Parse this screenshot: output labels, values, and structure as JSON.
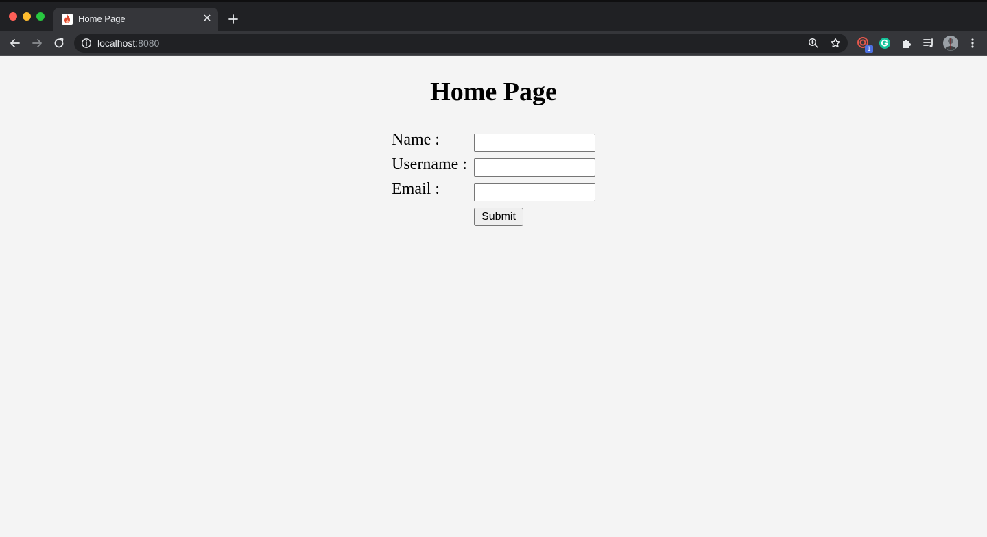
{
  "window": {
    "traffic_lights": [
      "close",
      "minimize",
      "zoom"
    ]
  },
  "tab": {
    "title": "Home Page",
    "favicon": "flame-favicon-icon",
    "close_glyph": "✕"
  },
  "address_bar": {
    "host": "localhost",
    "port": ":8080"
  },
  "extensions": {
    "badge_count": "1"
  },
  "page": {
    "title": "Home Page",
    "form": {
      "name_label": "Name :",
      "username_label": "Username :",
      "email_label": "Email :",
      "name_value": "",
      "username_value": "",
      "email_value": "",
      "submit_label": "Submit"
    }
  },
  "colors": {
    "chrome_dark": "#202124",
    "chrome_toolbar": "#35363a",
    "page_background": "#f4f4f4"
  }
}
